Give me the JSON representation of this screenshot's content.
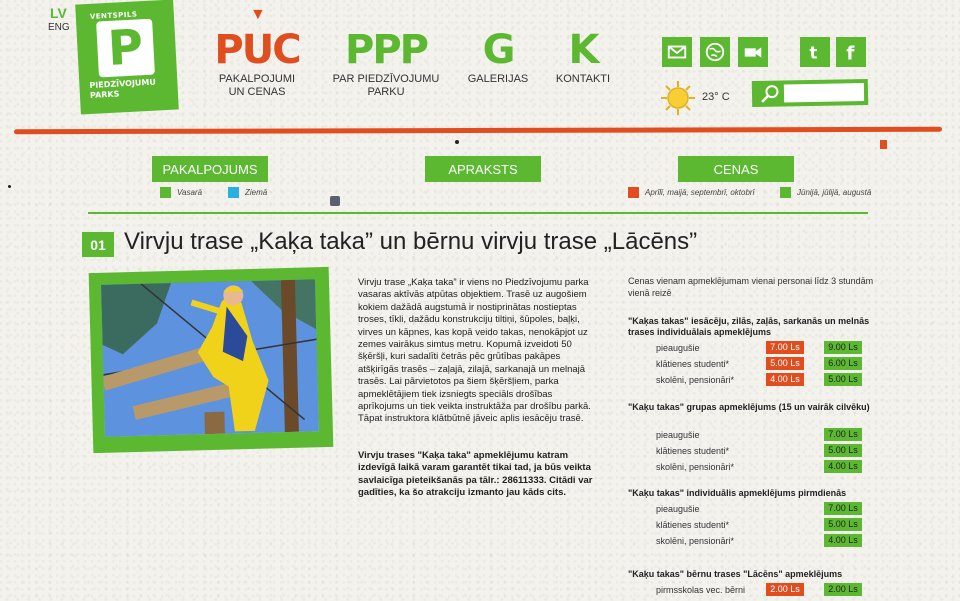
{
  "lang": {
    "active": "LV",
    "other": "ENG"
  },
  "logo": {
    "top": "VENTSPILS",
    "letter": "P",
    "bottom": "PIEDZĪVOJUMU PARKS"
  },
  "nav": [
    {
      "glyph": "PUC",
      "label_1": "PAKALPOJUMI",
      "label_2": "UN CENAS",
      "color": "#e04e20"
    },
    {
      "glyph": "PPP",
      "label_1": "PAR PIEDZĪVOJUMU",
      "label_2": "PARKU",
      "color": "#5bb830"
    },
    {
      "glyph": "G",
      "label_1": "GALERIJAS",
      "label_2": "",
      "color": "#5bb830"
    },
    {
      "glyph": "K",
      "label_1": "KONTAKTI",
      "label_2": "",
      "color": "#5bb830"
    }
  ],
  "social_icons": [
    "mail-icon",
    "globe-icon",
    "video-icon",
    "twitter-icon",
    "facebook-icon"
  ],
  "weather": {
    "temp": "23° C"
  },
  "columns": {
    "services": "PAKALPOJUMS",
    "description": "APRAKSTS",
    "prices": "CENAS"
  },
  "legend": {
    "summer": "Vasarā",
    "winter": "Ziemā",
    "season_1": "Aprīlī, maijā, septembrī, oktobrī",
    "season_2": "Jūnijā, jūlijā, augustā"
  },
  "colors": {
    "green": "#5bb830",
    "orange": "#e04e20",
    "blue": "#2ab0e0"
  },
  "page": {
    "number": "01",
    "title": "Virvju trase „Kaķa taka” un bērnu virvju trase „Lācēns”"
  },
  "description": "Virvju trase „Kaķa taka” ir viens no Piedzīvojumu parka vasaras aktīvās atpūtas objektiem. Trasē uz augošiem kokiem dažādā augstumā ir nostiprinātas nostieptas troses, tīkli, dažādu konstrukciju tiltiņi, šūpoles, baļķi, virves un kāpnes, kas kopā veido takas, nenokāpjot uz zemes vairākus simtus metru. Kopumā izveidoti 50 šķēršļi, kuri sadalīti četrās pēc grūtības pakāpes atšķirīgās trasēs – zaļajā, zilajā, sarkanajā un melnajā trasēs. Lai pārvietotos pa šiem šķēršļiem, parka apmeklētājiem tiek izsniegts speciāls drošības aprīkojums un tiek veikta instruktāža par drošību parkā. Tāpat instruktora klātbūtnē jāveic aplis iesācēju trasē.",
  "note": "Virvju trases \"Kaķa taka\" apmeklējumu katram izdevīgā laikā varam garantēt tikai tad, ja būs veikta savlaicīga pieteikšanās pa tālr.: 28611333. Citādi var gadīties, ka šo atrakciju izmanto jau kāds cits.",
  "prices": {
    "intro": "Cenas vienam apmeklējumam vienai personai līdz 3 stundām vienā reizē",
    "groups": [
      {
        "title": "\"Kaķas takas\" iesācēju, zilās, zaļās, sarkanās un melnās trases individuālais apmeklējums",
        "rows": [
          {
            "label": "pieaugušie",
            "orange": "7.00 Ls",
            "green": "9.00 Ls"
          },
          {
            "label": "klātienes studenti*",
            "orange": "5.00 Ls",
            "green": "6.00 Ls"
          },
          {
            "label": "skolēni, pensionāri*",
            "orange": "4.00 Ls",
            "green": "5.00 Ls"
          }
        ]
      },
      {
        "title": "\"Kaķu takas\" grupas apmeklējums (15 un vairāk cilvēku)",
        "rows": [
          {
            "label": "pieaugušie",
            "orange": "",
            "green": "7.00 Ls"
          },
          {
            "label": "klātienes studenti*",
            "orange": "",
            "green": "5.00 Ls"
          },
          {
            "label": "skolēni, pensionāri*",
            "orange": "",
            "green": "4.00 Ls"
          }
        ]
      },
      {
        "title": "\"Kaķu takas\" individuālis apmeklējums pirmdienās",
        "rows": [
          {
            "label": "pieaugušie",
            "orange": "",
            "green": "7.00 Ls"
          },
          {
            "label": "klātienes studenti*",
            "orange": "",
            "green": "5.00 Ls"
          },
          {
            "label": "skolēni, pensionāri*",
            "orange": "",
            "green": "4.00 Ls"
          }
        ]
      },
      {
        "title": "\"Kaķu takas\" bērnu trases \"Lācēns\" apmeklējums",
        "rows": [
          {
            "label": "pirmsskolas vec. bērni",
            "orange": "2.00 Ls",
            "green": "2.00 Ls"
          }
        ]
      }
    ]
  }
}
